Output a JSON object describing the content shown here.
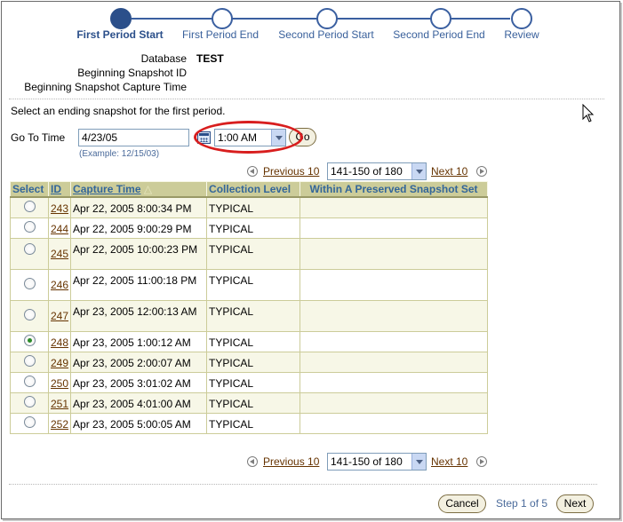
{
  "train": {
    "steps": [
      {
        "label": "First Period Start",
        "active": true
      },
      {
        "label": "First Period End",
        "active": false
      },
      {
        "label": "Second Period Start",
        "active": false
      },
      {
        "label": "Second Period End",
        "active": false
      },
      {
        "label": "Review",
        "active": false
      }
    ]
  },
  "info": {
    "database_label": "Database",
    "database_value": "TEST",
    "begin_snapshot_id_label": "Beginning Snapshot ID",
    "begin_capture_time_label": "Beginning Snapshot Capture Time"
  },
  "instruction": "Select an ending snapshot for the first period.",
  "goto": {
    "label": "Go To Time",
    "date_value": "4/23/05",
    "time_value": "1:00 AM",
    "go_label": "Go",
    "example": "(Example: 12/15/03)"
  },
  "pagination": {
    "previous_label": "Previous 10",
    "range_value": "141-150 of 180",
    "next_label": "Next 10"
  },
  "table": {
    "headers": {
      "select": "Select",
      "id": "ID",
      "capture_time": "Capture Time",
      "collection_level": "Collection Level",
      "preserved": "Within A Preserved Snapshot Set"
    },
    "rows": [
      {
        "id": "243",
        "time": "Apr 22, 2005 8:00:34 PM",
        "level": "TYPICAL",
        "preserved": "",
        "checked": false
      },
      {
        "id": "244",
        "time": "Apr 22, 2005 9:00:29 PM",
        "level": "TYPICAL",
        "preserved": "",
        "checked": false
      },
      {
        "id": "245",
        "time": "Apr 22, 2005 10:00:23 PM",
        "level": "TYPICAL",
        "preserved": "",
        "checked": false
      },
      {
        "id": "246",
        "time": "Apr 22, 2005 11:00:18 PM",
        "level": "TYPICAL",
        "preserved": "",
        "checked": false
      },
      {
        "id": "247",
        "time": "Apr 23, 2005 12:00:13 AM",
        "level": "TYPICAL",
        "preserved": "",
        "checked": false
      },
      {
        "id": "248",
        "time": "Apr 23, 2005 1:00:12 AM",
        "level": "TYPICAL",
        "preserved": "",
        "checked": true
      },
      {
        "id": "249",
        "time": "Apr 23, 2005 2:00:07 AM",
        "level": "TYPICAL",
        "preserved": "",
        "checked": false
      },
      {
        "id": "250",
        "time": "Apr 23, 2005 3:01:02 AM",
        "level": "TYPICAL",
        "preserved": "",
        "checked": false
      },
      {
        "id": "251",
        "time": "Apr 23, 2005 4:01:00 AM",
        "level": "TYPICAL",
        "preserved": "",
        "checked": false
      },
      {
        "id": "252",
        "time": "Apr 23, 2005 5:00:05 AM",
        "level": "TYPICAL",
        "preserved": "",
        "checked": false
      }
    ]
  },
  "footer": {
    "cancel_label": "Cancel",
    "step_text": "Step 1 of 5",
    "next_label": "Next"
  },
  "colors": {
    "train_blue": "#2b4f8a",
    "header_bg": "#cccc99",
    "header_text": "#336699",
    "link_brown": "#663300",
    "annotation_red": "#d81e1e"
  }
}
